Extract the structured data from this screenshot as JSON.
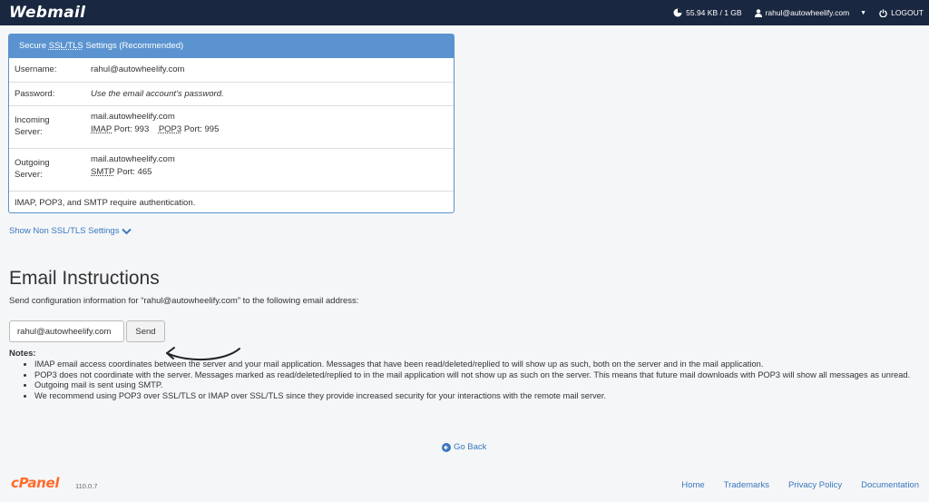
{
  "header": {
    "logo": "Webmail",
    "disk_usage": "55.94 KB / 1 GB",
    "user": "rahul@autowheelify.com",
    "logout": "LOGOUT"
  },
  "settings": {
    "title_prefix": "Secure ",
    "title_abbr": "SSL/TLS",
    "title_suffix": " Settings (Recommended)",
    "username_label": "Username:",
    "username_value": "rahul@autowheelify.com",
    "password_label": "Password:",
    "password_value": "Use the email account’s password.",
    "incoming_label": "Incoming Server:",
    "incoming_host": "mail.autowheelify.com",
    "imap_label": "IMAP",
    "imap_port": " Port: 993",
    "pop3_label": "POP3",
    "pop3_port": " Port: 995",
    "outgoing_label": "Outgoing Server:",
    "outgoing_host": "mail.autowheelify.com",
    "smtp_label": "SMTP",
    "smtp_port": " Port: 465",
    "auth_note": "IMAP, POP3, and SMTP require authentication."
  },
  "non_ssl_link": "Show Non SSL/TLS Settings",
  "instructions": {
    "heading": "Email Instructions",
    "description": "Send configuration information for “rahul@autowheelify.com” to the following email address:",
    "email_value": "rahul@autowheelify.com",
    "send_label": "Send"
  },
  "notes": {
    "title": "Notes:",
    "items": [
      "IMAP email access coordinates between the server and your mail application. Messages that have been read/deleted/replied to will show up as such, both on the server and in the mail application.",
      "POP3 does not coordinate with the server. Messages marked as read/deleted/replied to in the mail application will not show up as such on the server. This means that future mail downloads with POP3 will show all messages as unread.",
      "Outgoing mail is sent using SMTP.",
      "We recommend using POP3 over SSL/TLS or IMAP over SSL/TLS since they provide increased security for your interactions with the remote mail server."
    ]
  },
  "go_back": "Go Back",
  "footer": {
    "logo": "cPanel",
    "version": "110.0.7",
    "links": [
      "Home",
      "Trademarks",
      "Privacy Policy",
      "Documentation"
    ]
  },
  "colors": {
    "topbar": "#1a2740",
    "panel_accent": "#5a93cf",
    "link": "#3a78bd",
    "cpanel_orange": "#ff6c2c"
  },
  "icons": {
    "disk": "pie-chart-icon",
    "user": "user-icon",
    "logout": "power-icon",
    "chevron": "chevron-down-icon",
    "back": "arrow-left-circle-icon"
  }
}
